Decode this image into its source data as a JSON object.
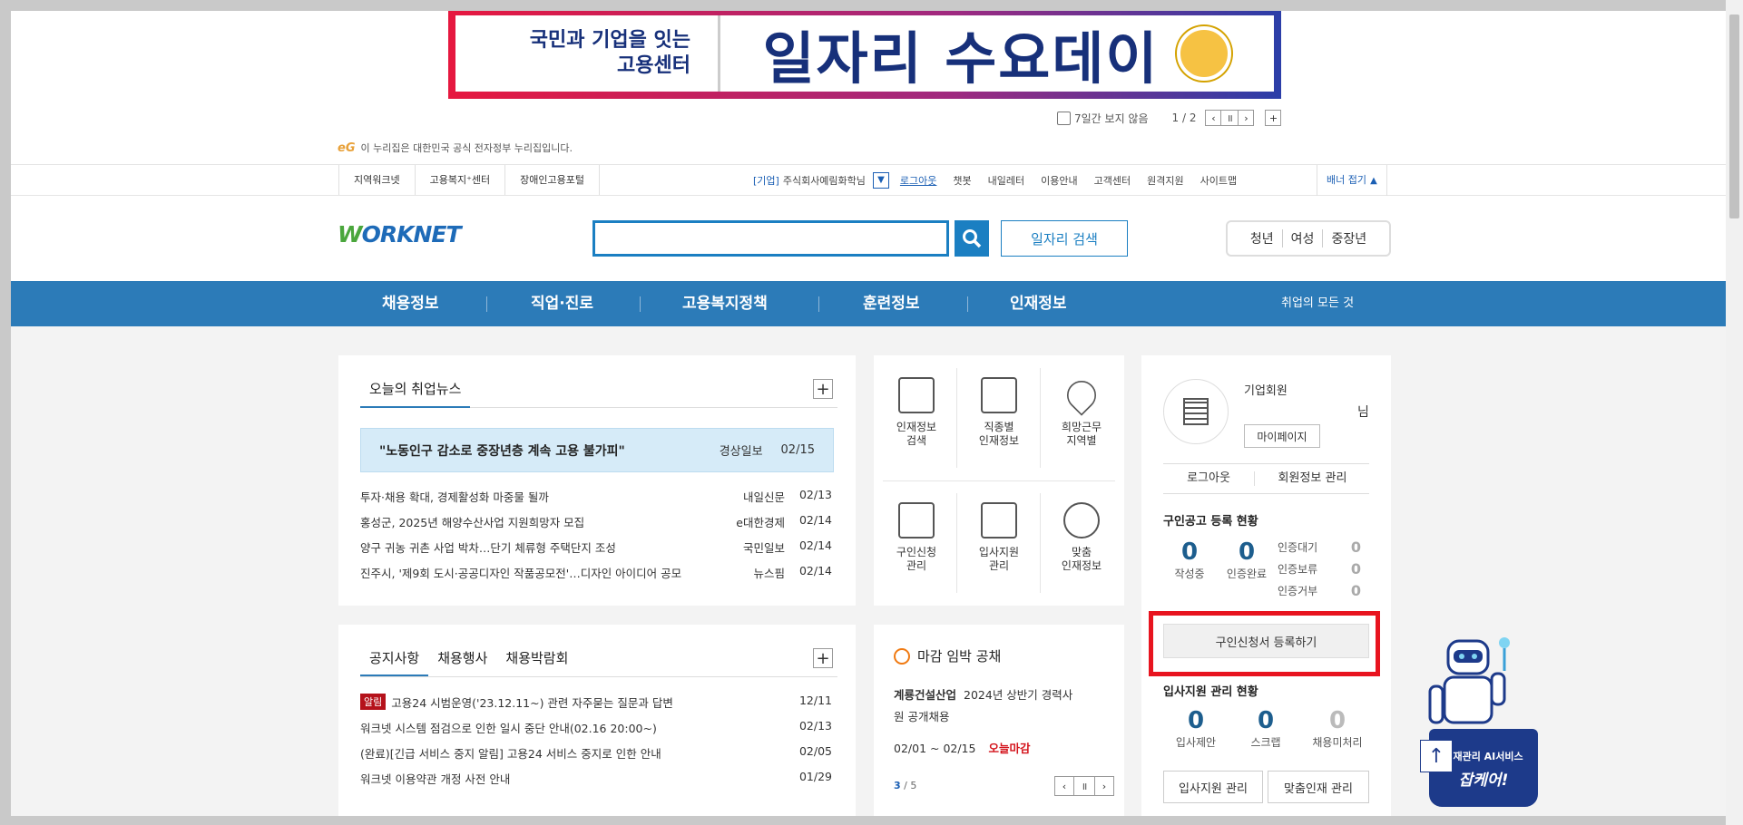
{
  "promo": {
    "left_line1": "국민과 기업을 잇는",
    "left_line2": "고용센터",
    "right_text": "일자리 수요데이"
  },
  "banner_controls": {
    "hide_7days": "7일간 보지 않음",
    "pager": "1 / 2",
    "prev": "‹",
    "pause": "॥",
    "next": "›",
    "add": "+"
  },
  "gov_notice": {
    "logo": "eG",
    "text": "이 누리집은 대한민국 공식 전자정부 누리집입니다."
  },
  "util_left": [
    "지역워크넷",
    "고용복지⁺센터",
    "장애인고용포털"
  ],
  "util_right": {
    "company": "[기업]",
    "user": "주식회사예림화학님",
    "logout": "로그아웃",
    "items": [
      "챗봇",
      "내일레터",
      "이용안내",
      "고객센터",
      "원격지원",
      "사이트맵"
    ],
    "fold": "배너 접기"
  },
  "header": {
    "logo_w": "W",
    "logo_rest": "ORKNET",
    "search_placeholder": "",
    "job_search": "일자리 검색",
    "age_tabs": [
      "청년",
      "여성",
      "중장년"
    ]
  },
  "nav": {
    "items": [
      "채용정보",
      "직업·진로",
      "고용복지정책",
      "훈련정보",
      "인재정보"
    ],
    "all": "취업의 모든 것"
  },
  "news": {
    "tab": "오늘의 취업뉴스",
    "headline": {
      "title": "\"노동인구 감소로 중장년층 계속 고용 불가피\"",
      "source": "경상일보",
      "date": "02/15"
    },
    "items": [
      {
        "title": "투자·채용 확대, 경제활성화 마중물 될까",
        "source": "내일신문",
        "date": "02/13"
      },
      {
        "title": "홍성군, 2025년 해양수산사업 지원희망자 모집",
        "source": "e대한경제",
        "date": "02/14"
      },
      {
        "title": "양구 귀농 귀촌 사업 박차…단기 체류형 주택단지 조성",
        "source": "국민일보",
        "date": "02/14"
      },
      {
        "title": "진주시, '제9회 도시·공공디자인 작품공모전'…디자인 아이디어 공모",
        "source": "뉴스핌",
        "date": "02/14"
      }
    ]
  },
  "quick_menu": [
    {
      "line1": "인재정보",
      "line2": "검색"
    },
    {
      "line1": "직종별",
      "line2": "인재정보"
    },
    {
      "line1": "희망근무",
      "line2": "지역별"
    },
    {
      "line1": "구인신청",
      "line2": "관리"
    },
    {
      "line1": "입사지원",
      "line2": "관리"
    },
    {
      "line1": "맞춤",
      "line2": "인재정보"
    }
  ],
  "notice": {
    "tabs": [
      "공지사항",
      "채용행사",
      "채용박람회"
    ],
    "badge": "알림",
    "items": [
      {
        "title": "고용24 시범운영('23.12.11~) 관련 자주묻는 질문과 답변",
        "date": "12/11"
      },
      {
        "title": "워크넷 시스템 점검으로 인한 일시 중단 안내(02.16 20:00~)",
        "date": "02/13"
      },
      {
        "title": "(완료)[긴급 서비스 중지 알림] 고용24 서비스 중지로 인한 안내",
        "date": "02/05"
      },
      {
        "title": "워크넷 이용약관 개정 사전 안내",
        "date": "01/29"
      }
    ]
  },
  "deadline": {
    "title": "마감 임박 공채",
    "company": "계룡건설산업",
    "desc_line1": "2024년 상반기 경력사",
    "desc_line2": "원 공개채용",
    "period": "02/01 ~ 02/15",
    "status": "오늘마감",
    "page_cur": "3",
    "page_total": "/ 5"
  },
  "member": {
    "type": "기업회원",
    "suffix": "님",
    "mypage": "마이페이지",
    "logout": "로그아웃",
    "manage": "회원정보 관리",
    "job_status_title": "구인공고 등록 현황",
    "writing": {
      "value": "0",
      "label": "작성중"
    },
    "certified": {
      "value": "0",
      "label": "인증완료"
    },
    "waiting": {
      "label": "인증대기",
      "value": "0"
    },
    "hold": {
      "label": "인증보류",
      "value": "0"
    },
    "reject": {
      "label": "인증거부",
      "value": "0"
    },
    "register_btn": "구인신청서 등록하기",
    "apply_status_title": "입사지원 관리 현황",
    "offer": {
      "value": "0",
      "label": "입사제안"
    },
    "scrap": {
      "value": "0",
      "label": "스크랩"
    },
    "unprocessed": {
      "value": "0",
      "label": "채용미처리"
    },
    "apply_manage": "입사지원 관리",
    "match_manage": "맞춤인재 관리"
  },
  "robot": {
    "line1": "인재관리 AI서비스",
    "line2": "잡케어!",
    "top_btn": "↑"
  },
  "colors": {
    "nav": "#2c7bb8",
    "highlight": "#e8141f",
    "accent": "#1b7fc2"
  }
}
